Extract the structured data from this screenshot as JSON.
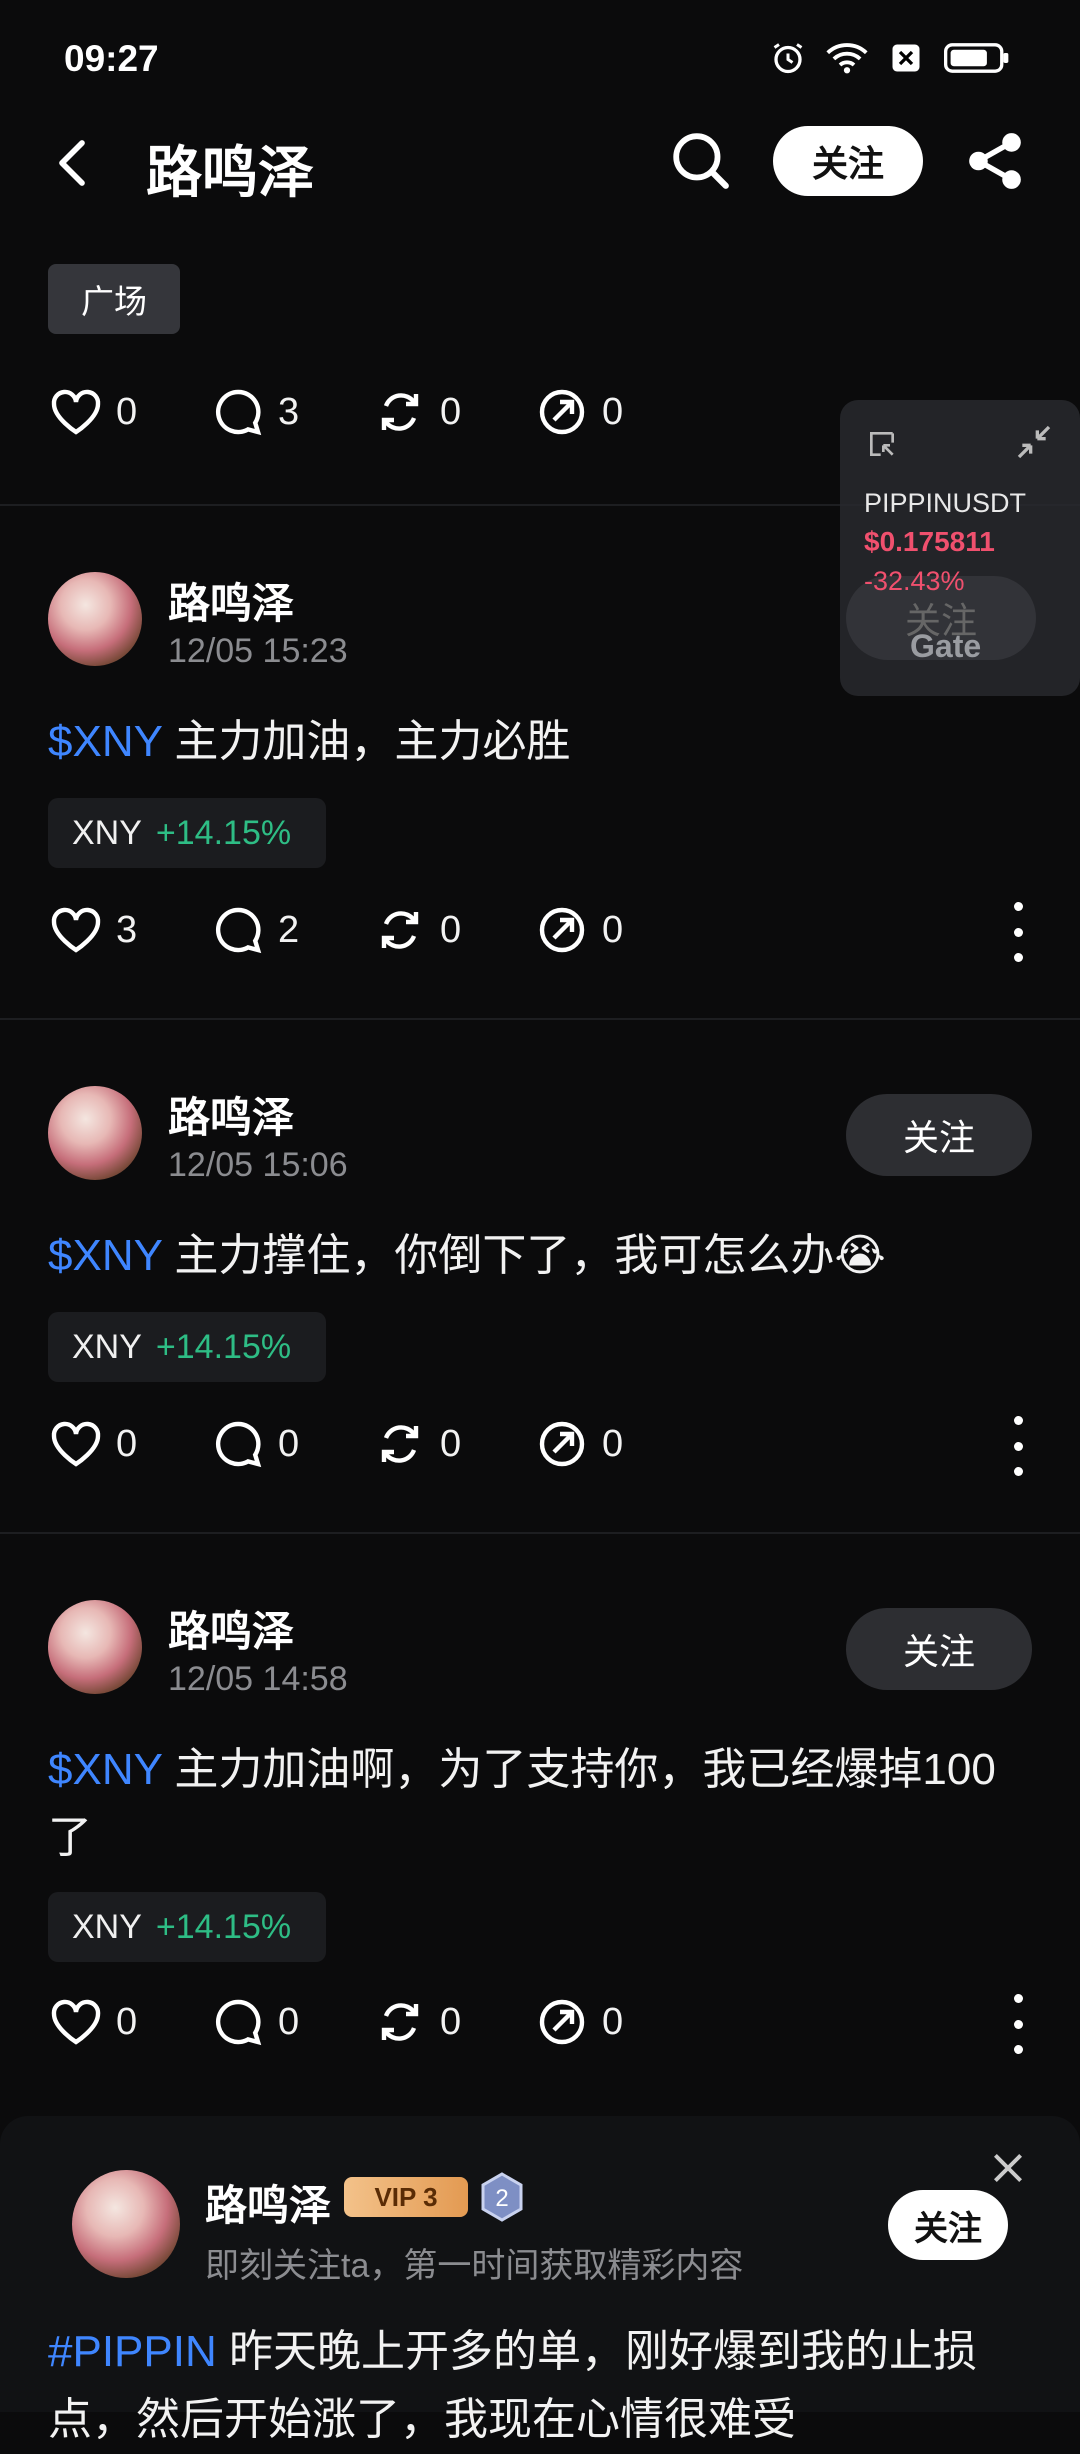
{
  "status_bar": {
    "time": "09:27"
  },
  "header": {
    "title": "路鸣泽",
    "follow_label": "关注"
  },
  "chip": {
    "label": "广场"
  },
  "top_actions": {
    "likes": "0",
    "comments": "3",
    "reposts": "0",
    "shares": "0"
  },
  "posts": [
    {
      "name": "路鸣泽",
      "time": "12/05 15:23",
      "tag": "$XNY",
      "text": " 主力加油，主力必胜",
      "ticker": {
        "symbol": "XNY",
        "change": "+14.15%"
      },
      "likes": "3",
      "comments": "2",
      "reposts": "0",
      "shares": "0",
      "follow_label": "关注"
    },
    {
      "name": "路鸣泽",
      "time": "12/05 15:06",
      "tag": "$XNY",
      "text": " 主力撑住，你倒下了，我可怎么办😭",
      "ticker": {
        "symbol": "XNY",
        "change": "+14.15%"
      },
      "likes": "0",
      "comments": "0",
      "reposts": "0",
      "shares": "0",
      "follow_label": "关注"
    },
    {
      "name": "路鸣泽",
      "time": "12/05 14:58",
      "tag": "$XNY",
      "text": " 主力加油啊，为了支持你，我已经爆掉100了",
      "ticker": {
        "symbol": "XNY",
        "change": "+14.15%"
      },
      "likes": "0",
      "comments": "0",
      "reposts": "0",
      "shares": "0",
      "follow_label": "关注"
    }
  ],
  "widget": {
    "symbol": "PIPPINUSDT",
    "price": "$0.175811",
    "change": "-32.43%",
    "brand": "Gate"
  },
  "follow_card": {
    "name": "路鸣泽",
    "vip": "VIP 3",
    "level": "2",
    "subtitle": "即刻关注ta，第一时间获取精彩内容",
    "follow_label": "关注",
    "tag": "#PIPPIN",
    "text": " 昨天晚上开多的单，刚好爆到我的止损点，然后开始涨了，我现在心情很难受"
  },
  "colors": {
    "background": "#0b0b0c",
    "accent_blue": "#3f86ff",
    "up_green": "#2ebd85",
    "down_red": "#f0506e"
  }
}
